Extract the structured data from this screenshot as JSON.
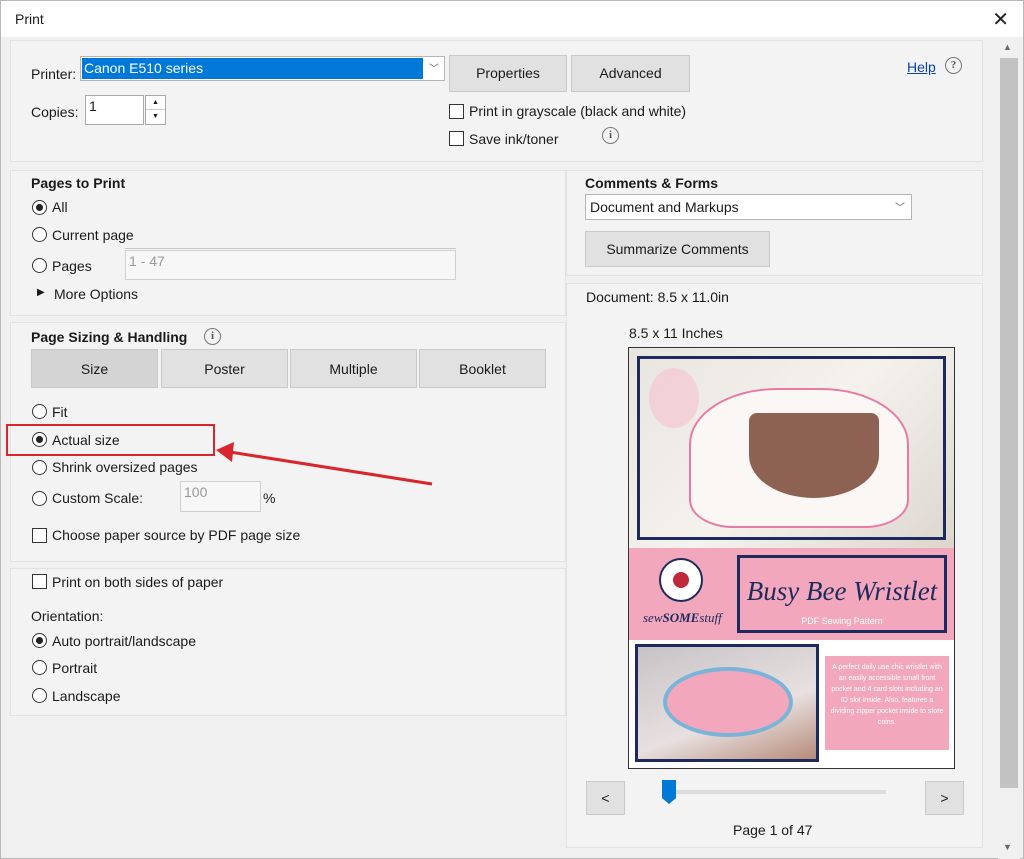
{
  "window": {
    "title": "Print",
    "close": "✕"
  },
  "printer": {
    "label": "Printer:",
    "selected": "Canon E510 series",
    "properties_btn": "Properties",
    "advanced_btn": "Advanced"
  },
  "copies": {
    "label": "Copies:",
    "value": "1"
  },
  "options": {
    "grayscale": "Print in grayscale (black and white)",
    "save_ink": "Save ink/toner"
  },
  "help": {
    "label": "Help",
    "icon": "?"
  },
  "pages_to_print": {
    "title": "Pages to Print",
    "all": "All",
    "current": "Current page",
    "pages": "Pages",
    "pages_value": "1 - 47",
    "more_options": "More Options"
  },
  "sizing": {
    "title": "Page Sizing & Handling",
    "tabs": [
      "Size",
      "Poster",
      "Multiple",
      "Booklet"
    ],
    "fit": "Fit",
    "actual": "Actual size",
    "shrink": "Shrink oversized pages",
    "custom": "Custom Scale:",
    "custom_value": "100",
    "percent": "%",
    "paper_source": "Choose paper source by PDF page size"
  },
  "duplex": {
    "label": "Print on both sides of paper"
  },
  "orientation": {
    "title": "Orientation:",
    "auto": "Auto portrait/landscape",
    "portrait": "Portrait",
    "landscape": "Landscape"
  },
  "comments": {
    "title": "Comments & Forms",
    "selected": "Document and Markups",
    "summarize_btn": "Summarize Comments"
  },
  "preview": {
    "document_size": "Document: 8.5 x 11.0in",
    "paper_label": "8.5 x 11 Inches",
    "brand_sew": "sew",
    "brand_some": "SOME",
    "brand_stuff": "stuff",
    "product_title": "Busy Bee Wristlet",
    "product_subtitle": "PDF Sewing Pattern",
    "description": "A perfect daily use chic wristlet with an easily accessible small front pocket and 4 card slots including an ID slot inside. Also, features a dividing zipper pocket inside to store coins.",
    "prev_btn": "<",
    "next_btn": ">",
    "page_indicator": "Page 1 of 47"
  },
  "colors": {
    "highlight": "#0078d7",
    "annotation": "#d9262c",
    "pink": "#f2a7bc",
    "navy": "#1f2a5c"
  }
}
